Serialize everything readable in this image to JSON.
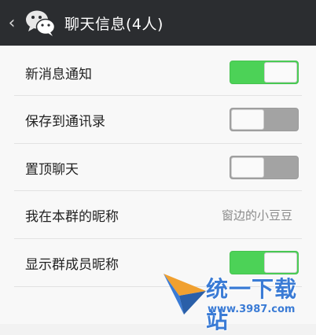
{
  "header": {
    "back_glyph": "‹",
    "title": "聊天信息(4人)",
    "logo_icon": "wechat-logo-icon"
  },
  "settings": {
    "rows": [
      {
        "label": "新消息通知",
        "type": "toggle",
        "state": "on"
      },
      {
        "label": "保存到通讯录",
        "type": "toggle",
        "state": "off"
      },
      {
        "label": "置顶聊天",
        "type": "toggle",
        "state": "off"
      },
      {
        "label": "我在本群的昵称",
        "type": "value",
        "value": "窗边的小豆豆"
      },
      {
        "label": "显示群成员昵称",
        "type": "toggle",
        "state": "on"
      }
    ]
  },
  "watermark": {
    "brand": "统一下载站",
    "url": "www.3987.com"
  },
  "colors": {
    "header_bg": "#2b2d30",
    "toggle_on": "#4cd257",
    "toggle_off": "#a3a3a3",
    "watermark": "#3a7bd5"
  }
}
